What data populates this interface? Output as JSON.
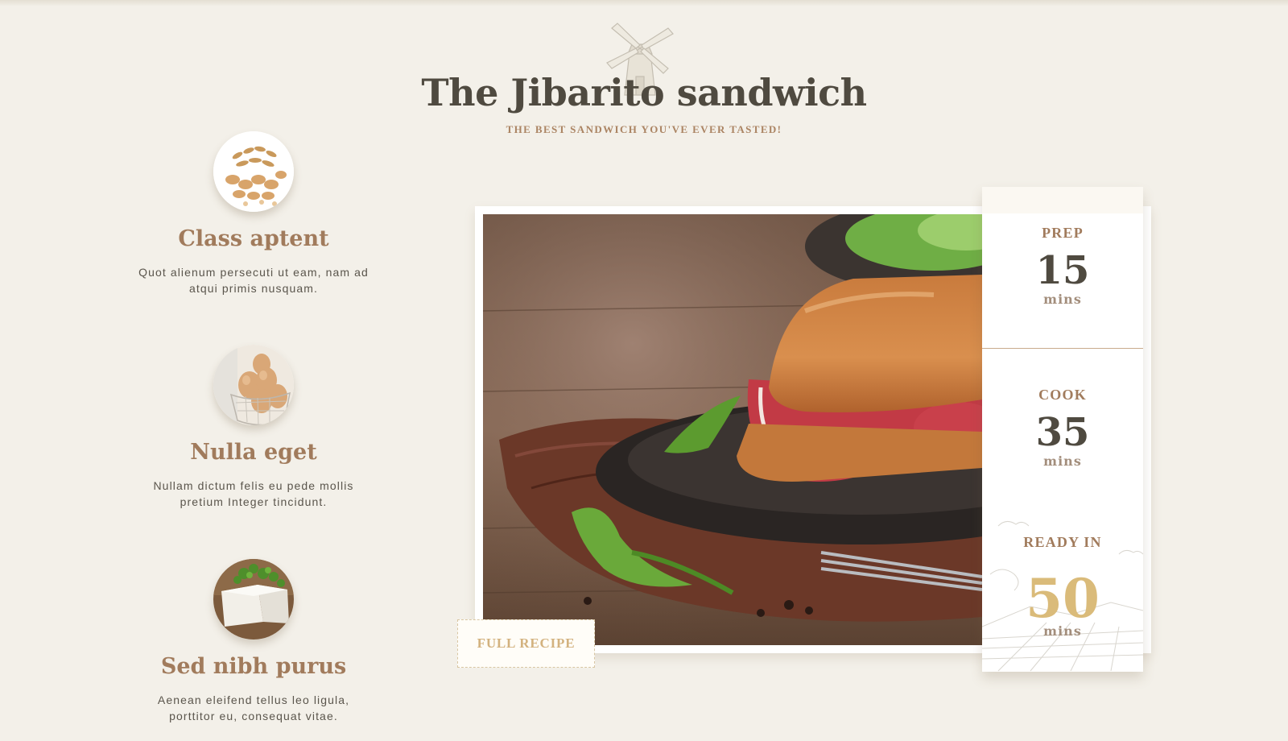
{
  "header": {
    "title": "The Jibarito sandwich",
    "subtitle": "THE BEST SANDWICH YOU'VE EVER TASTED!"
  },
  "features": [
    {
      "title": "Class aptent",
      "text": "Quot alienum persecuti ut eam, nam ad atqui primis nusquam.",
      "icon": "grains-icon"
    },
    {
      "title": "Nulla eget",
      "text": "Nullam dictum felis eu pede mollis pretium Integer tincidunt.",
      "icon": "eggs-icon"
    },
    {
      "title": "Sed nibh purus",
      "text": "Aenean eleifend tellus leo ligula, porttitor eu, consequat vitae.",
      "icon": "cheese-icon"
    }
  ],
  "photo": {
    "subject": "sandwich-photo"
  },
  "full_recipe_label": "FULL RECIPE",
  "stats": {
    "prep": {
      "label": "PREP",
      "value": "15",
      "unit": "mins"
    },
    "cook": {
      "label": "COOK",
      "value": "35",
      "unit": "mins"
    },
    "ready": {
      "label": "READY IN",
      "value": "50",
      "unit": "mins"
    }
  },
  "colors": {
    "background": "#f3f0e9",
    "title": "#4f4a40",
    "accent_brown": "#a17b5c",
    "accent_gold": "#dabb7a"
  }
}
